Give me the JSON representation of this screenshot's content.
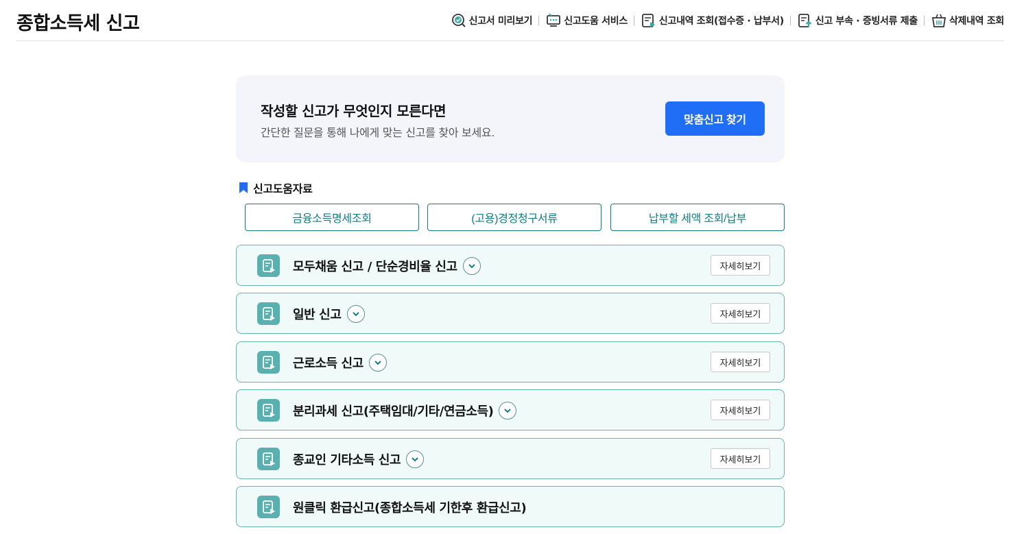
{
  "header": {
    "title": "종합소득세 신고",
    "nav": [
      {
        "label": "신고서 미리보기",
        "icon": "preview-check-icon"
      },
      {
        "label": "신고도움 서비스",
        "icon": "help-monitor-icon"
      },
      {
        "label": "신고내역 조회(접수증 · 납부서)",
        "icon": "history-doc-icon"
      },
      {
        "label": "신고 부속 · 증빙서류 제출",
        "icon": "upload-doc-icon"
      },
      {
        "label": "삭제내역 조회",
        "icon": "trash-basket-icon"
      }
    ]
  },
  "hero": {
    "title": "작성할 신고가 무엇인지 모른다면",
    "subtitle": "간단한 질문을 통해 나에게 맞는 신고를 찾아 보세요.",
    "button": "맞춤신고 찾기"
  },
  "help": {
    "title": "신고도움자료",
    "buttons": [
      "금융소득명세조회",
      "(고용)경정청구서류",
      "납부할 세액 조회/납부"
    ]
  },
  "filings": [
    {
      "label": "모두채움 신고 / 단순경비율 신고",
      "expandable": true,
      "detail": "자세히보기"
    },
    {
      "label": "일반 신고",
      "expandable": true,
      "detail": "자세히보기"
    },
    {
      "label": "근로소득 신고",
      "expandable": true,
      "detail": "자세히보기"
    },
    {
      "label": "분리과세 신고(주택임대/기타/연금소득)",
      "expandable": true,
      "detail": "자세히보기"
    },
    {
      "label": "종교인 기타소득 신고",
      "expandable": true,
      "detail": "자세히보기"
    },
    {
      "label": "원클릭 환급신고(종합소득세 기한후 환급신고)",
      "expandable": false,
      "detail": ""
    }
  ],
  "colors": {
    "accent": "#1f6ef5",
    "teal": "#0f7d83",
    "card_bg": "#f0faf9",
    "card_border": "#64b4b0",
    "icon_bg": "#5ab0ae"
  }
}
